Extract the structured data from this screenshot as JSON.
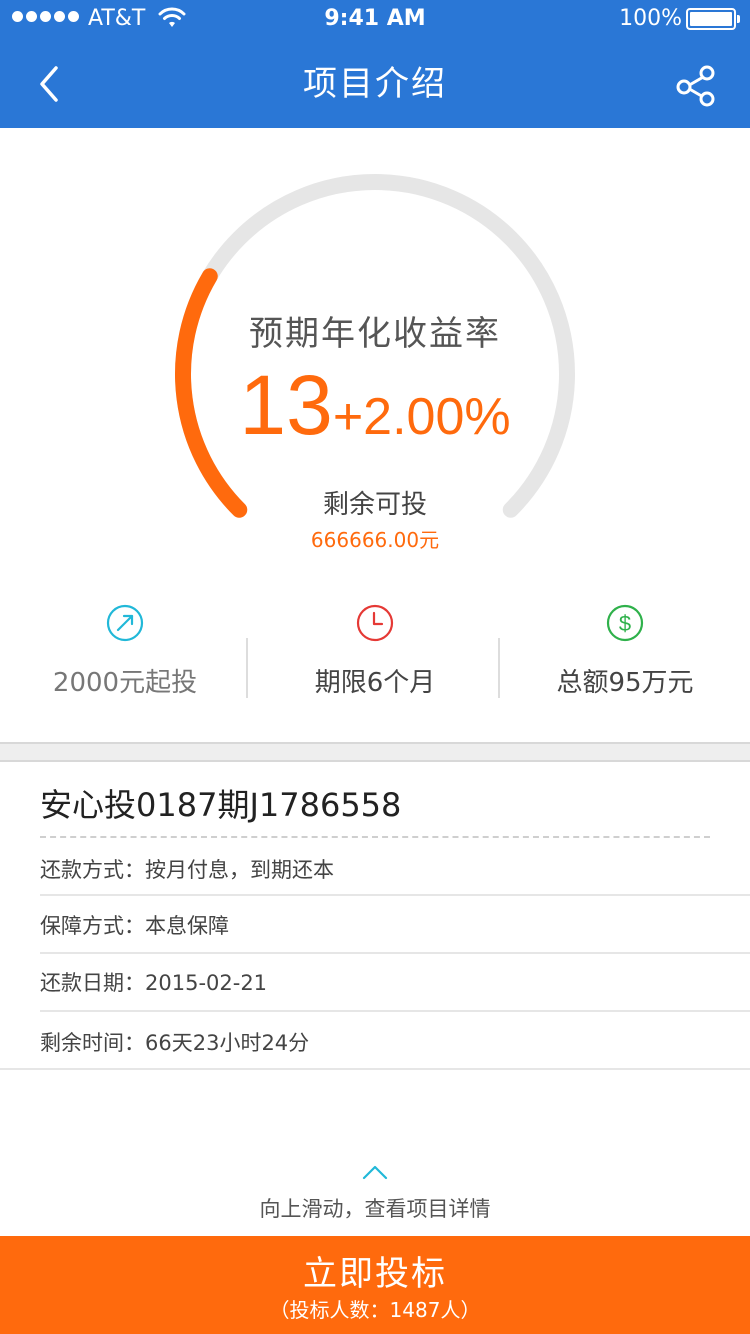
{
  "status_bar": {
    "carrier": "AT&T",
    "time": "9:41 AM",
    "battery": "100%"
  },
  "nav": {
    "title": "项目介绍",
    "back_icon": "chevron-left-icon",
    "share_icon": "share-icon"
  },
  "gauge": {
    "label": "预期年化收益率",
    "rate_main": "13",
    "rate_extra": "+2.00%",
    "remaining_label": "剩余可投",
    "remaining_value": "666666.00元",
    "progress_fraction": 0.28,
    "colors": {
      "progress": "#ff6a0d",
      "track": "#e6e6e6"
    }
  },
  "features": [
    {
      "icon": "arrow-up-right-icon",
      "text": "2000元起投",
      "color": "#21b8d8"
    },
    {
      "icon": "clock-icon",
      "text": "期限6个月",
      "color": "#e53935"
    },
    {
      "icon": "dollar-icon",
      "text": "总额95万元",
      "color": "#2fb14b"
    }
  ],
  "details": {
    "title": "安心投0187期J1786558",
    "rows": [
      {
        "text": "还款方式：按月付息，到期还本"
      },
      {
        "text": "保障方式：本息保障"
      },
      {
        "text": "还款日期：2015-02-21"
      },
      {
        "text": "剩余时间：66天23小时24分"
      }
    ]
  },
  "swipe_hint": "向上滑动，查看项目详情",
  "invest": {
    "label": "立即投标",
    "count": "（投标人数：1487人）"
  },
  "colors": {
    "header": "#2a77d6",
    "accent": "#ff6a0d"
  }
}
